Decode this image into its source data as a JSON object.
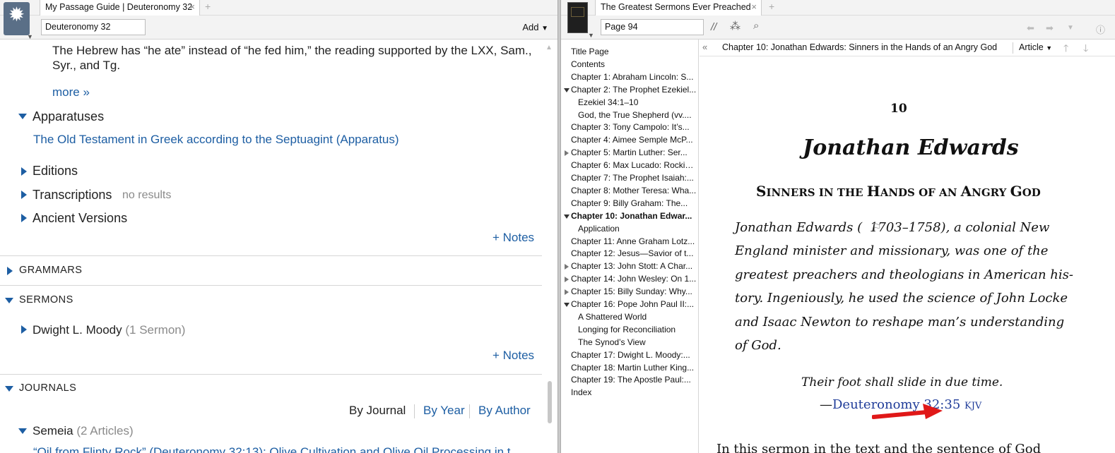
{
  "left": {
    "tab_title": "My Passage Guide | Deuteronomy 32",
    "reference": "Deuteronomy 32",
    "add_label": "Add",
    "note_text_line1": "The Hebrew has “he ate” instead of “he fed him,” the reading supported by the LXX, Sam.,",
    "note_text_line2": "Syr., and Tg.",
    "more_link": "more »",
    "apparatuses_label": "Apparatuses",
    "apparatus_link": "The Old Testament in Greek according to the Septuagint (Apparatus)",
    "editions_label": "Editions",
    "transcriptions_label": "Transcriptions",
    "transcriptions_status": "no results",
    "ancient_versions_label": "Ancient Versions",
    "notes_label": "+ Notes",
    "grammars_label": "GRAMMARS",
    "sermons_label": "SERMONS",
    "sermon_author": "Dwight L. Moody",
    "sermon_count": "(1 Sermon)",
    "journals_label": "JOURNALS",
    "by_journal": "By Journal",
    "by_year": "By Year",
    "by_author": "By Author",
    "semeia_label": "Semeia",
    "semeia_count": "(2 Articles)",
    "partial_article": "“Oil from Flinty Rock” (Deuteronomy 32:13): Olive Cultivation and Olive Oil Processing in t"
  },
  "right": {
    "tab_title": "The Greatest Sermons Ever Preached",
    "page_field": "Page 94",
    "header_title": "Chapter 10: Jonathan Edwards: Sinners in the Hands of an Angry God",
    "article_label": "Article",
    "toc": [
      {
        "label": "Title Page"
      },
      {
        "label": "Contents"
      },
      {
        "label": "Chapter 1: Abraham Lincoln: S..."
      },
      {
        "label": "Chapter 2: The Prophet Ezekiel..."
      },
      {
        "label": "Ezekiel 34:1–10"
      },
      {
        "label": "God, the True Shepherd (vv...."
      },
      {
        "label": "Chapter 3: Tony Campolo: It’s..."
      },
      {
        "label": "Chapter 4: Aimee Semple McP..."
      },
      {
        "label": "Chapter 5: Martin Luther: Ser..."
      },
      {
        "label": "Chapter 6: Max Lucado: Rockin..."
      },
      {
        "label": "Chapter 7: The Prophet Isaiah:..."
      },
      {
        "label": "Chapter 8: Mother Teresa: Wha..."
      },
      {
        "label": "Chapter 9: Billy Graham: The..."
      },
      {
        "label": "Chapter 10: Jonathan Edwar..."
      },
      {
        "label": "Application"
      },
      {
        "label": "Chapter 11: Anne Graham Lotz..."
      },
      {
        "label": "Chapter 12: Jesus—Savior of t..."
      },
      {
        "label": "Chapter 13: John Stott: A Char..."
      },
      {
        "label": "Chapter 14: John Wesley: On 1..."
      },
      {
        "label": "Chapter 15: Billy Sunday: Why..."
      },
      {
        "label": "Chapter 16: Pope John Paul II:..."
      },
      {
        "label": "A Shattered World"
      },
      {
        "label": "Longing for Reconciliation"
      },
      {
        "label": "The Synod’s View"
      },
      {
        "label": "Chapter 17: Dwight L. Moody:..."
      },
      {
        "label": "Chapter 18: Martin Luther King..."
      },
      {
        "label": "Chapter 19: The Apostle Paul:..."
      },
      {
        "label": "Index"
      }
    ],
    "chapter_number": "10",
    "chapter_name": "Jonathan Edwards",
    "subtitle_cap1": "S",
    "subtitle_rest1": "INNERS IN THE ",
    "subtitle_cap2": "H",
    "subtitle_rest2": "ANDS OF AN ",
    "subtitle_cap3": "A",
    "subtitle_rest3": "NGRY ",
    "subtitle_cap4": "G",
    "subtitle_rest4": "OD",
    "bio_lines": [
      "Jonathan Edwards (   1703–1758), a colonial New",
      "England minister and missionary, was one of the",
      "greatest preachers and theologians in American his-",
      "tory. Ingeniously, he used the science of John Locke",
      "and Isaac Newton to reshape man’s understanding",
      "of God."
    ],
    "epigraph": "Their foot shall slide in due time.",
    "epigraph_dash": "—",
    "epigraph_ref": "Deuteronomy 32:35",
    "epigraph_version": "KJV",
    "body_partial": "In this sermon in the text and the sentence of God"
  }
}
